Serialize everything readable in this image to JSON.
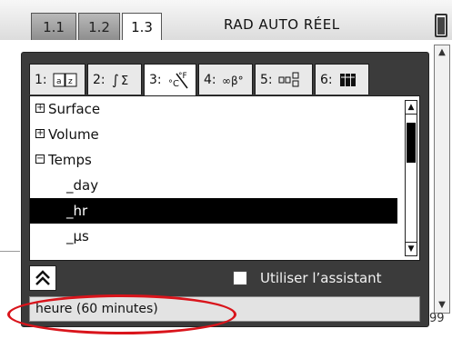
{
  "doc_tabs": [
    {
      "label": "1.1",
      "active": false
    },
    {
      "label": "1.2",
      "active": false
    },
    {
      "label": "1.3",
      "active": true
    }
  ],
  "status_mode": "RAD AUTO RÉEL",
  "catalog_tabs": [
    {
      "number": "1:",
      "icon": "book-icon"
    },
    {
      "number": "2:",
      "icon": "integral-sum-icon"
    },
    {
      "number": "3:",
      "icon": "units-icon"
    },
    {
      "number": "4:",
      "icon": "symbols-icon"
    },
    {
      "number": "5:",
      "icon": "templates-icon"
    },
    {
      "number": "6:",
      "icon": "libraries-icon"
    }
  ],
  "catalog_list": [
    {
      "label": "Surface",
      "type": "category",
      "expander": "+"
    },
    {
      "label": "Volume",
      "type": "category",
      "expander": "+"
    },
    {
      "label": "Temps",
      "type": "category",
      "expander": "−"
    },
    {
      "label": "_day",
      "type": "item"
    },
    {
      "label": "_hr",
      "type": "item",
      "selected": true
    },
    {
      "label": "_µs",
      "type": "item"
    }
  ],
  "wizard_label": "Utiliser l’assistant",
  "wizard_checked": false,
  "description": "heure (60 minutes)",
  "background_peek": "99",
  "colors": {
    "annotation": "#d9141b",
    "dialog": "#3b3b3b"
  }
}
